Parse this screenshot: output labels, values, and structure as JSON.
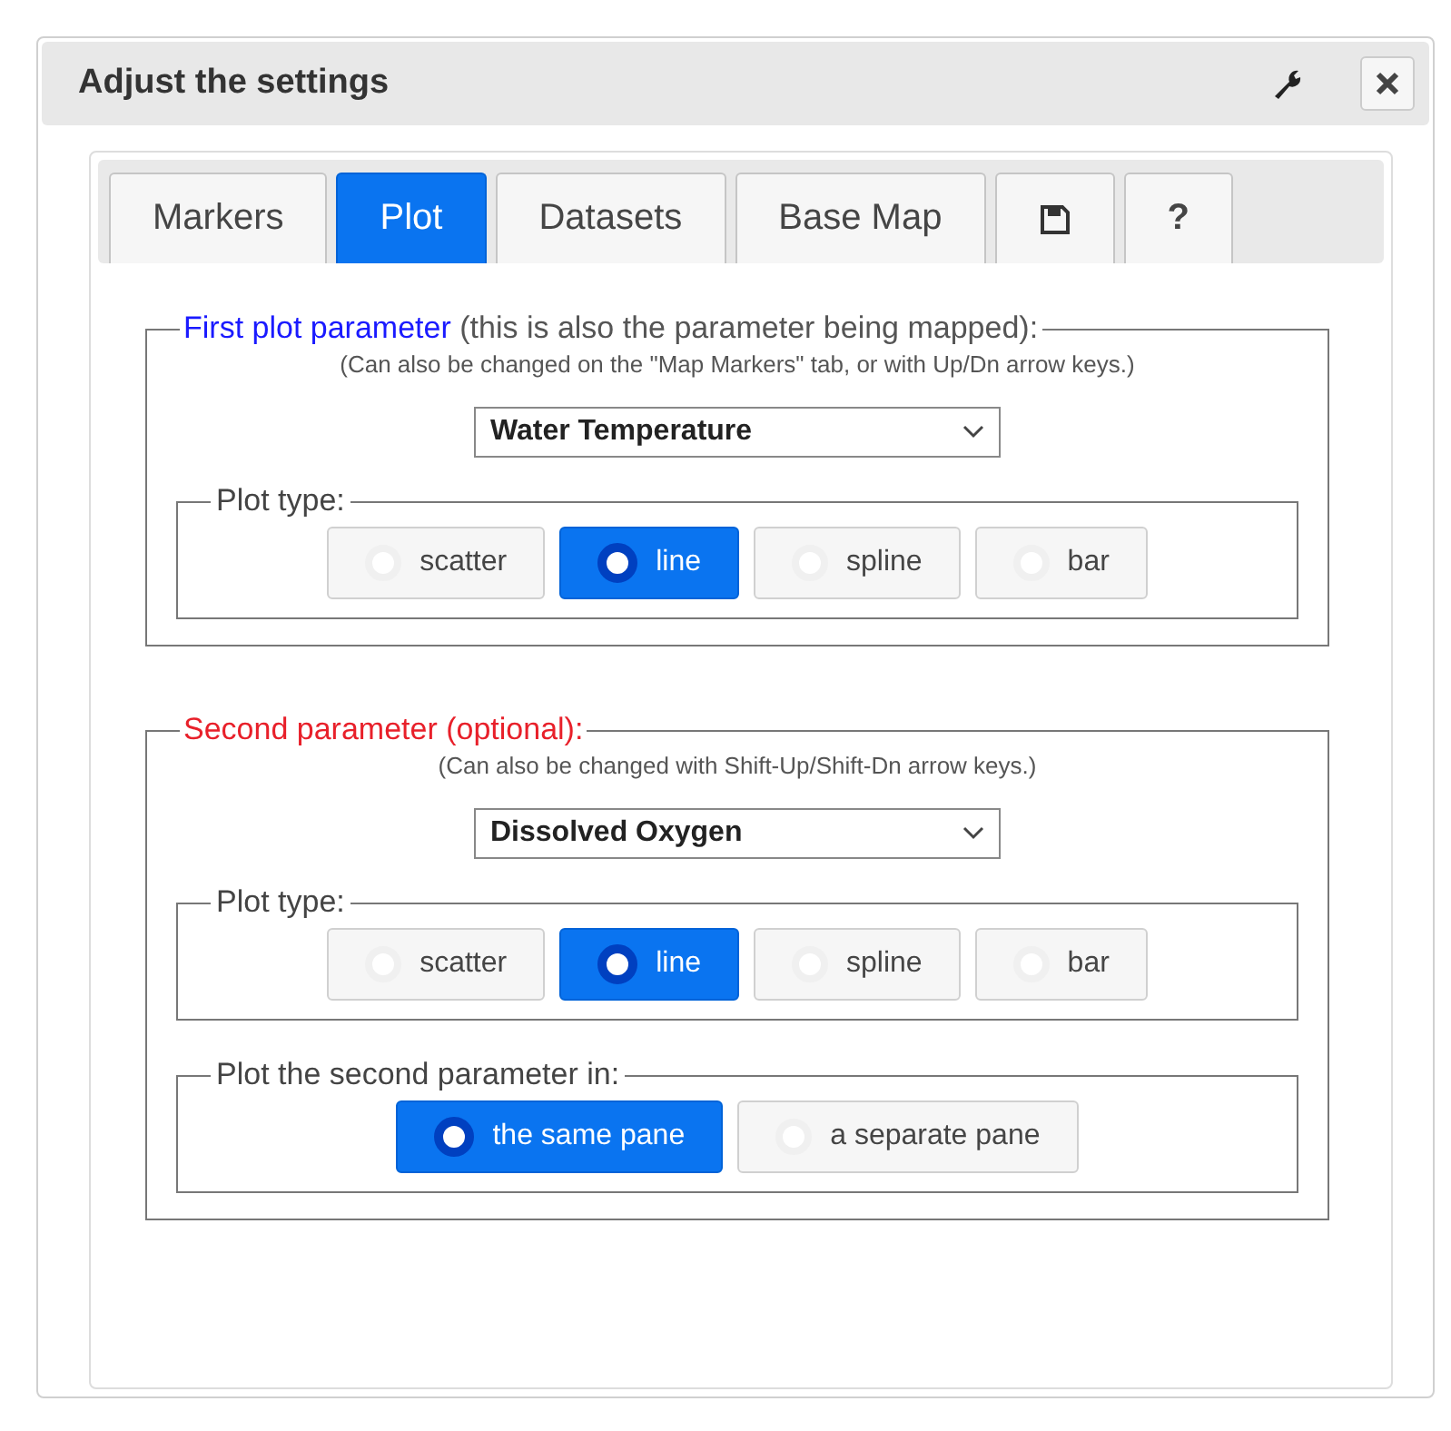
{
  "window": {
    "title": "Adjust the settings"
  },
  "tabs": [
    {
      "label": "Markers",
      "kind": "text",
      "selected": false
    },
    {
      "label": "Plot",
      "kind": "text",
      "selected": true
    },
    {
      "label": "Datasets",
      "kind": "text",
      "selected": false
    },
    {
      "label": "Base Map",
      "kind": "text",
      "selected": false
    },
    {
      "kind": "save",
      "selected": false
    },
    {
      "label": "?",
      "kind": "text",
      "selected": false
    }
  ],
  "sections": [
    {
      "title": "First plot parameter",
      "color": "#1a1aff",
      "note": "(this is also the parameter being mapped):",
      "hint": "(Can also be changed on the \"Map Markers\" tab, or with Up/Dn arrow keys.)",
      "select": "Water Temperature",
      "groups": [
        {
          "label": "Plot type:",
          "options": [
            {
              "label": "scatter",
              "selected": false
            },
            {
              "label": "line",
              "selected": true
            },
            {
              "label": "spline",
              "selected": false
            },
            {
              "label": "bar",
              "selected": false
            }
          ]
        }
      ]
    },
    {
      "title": "Second parameter (optional):",
      "color": "#e8202a",
      "hint": "(Can also be changed with Shift-Up/Shift-Dn arrow keys.)",
      "select": "Dissolved Oxygen",
      "groups": [
        {
          "label": "Plot type:",
          "options": [
            {
              "label": "scatter",
              "selected": false
            },
            {
              "label": "line",
              "selected": true
            },
            {
              "label": "spline",
              "selected": false
            },
            {
              "label": "bar",
              "selected": false
            }
          ]
        },
        {
          "label": "Plot the second parameter in:",
          "options": [
            {
              "label": "the same pane",
              "selected": true
            },
            {
              "label": "a separate pane",
              "selected": false
            }
          ]
        }
      ]
    }
  ]
}
